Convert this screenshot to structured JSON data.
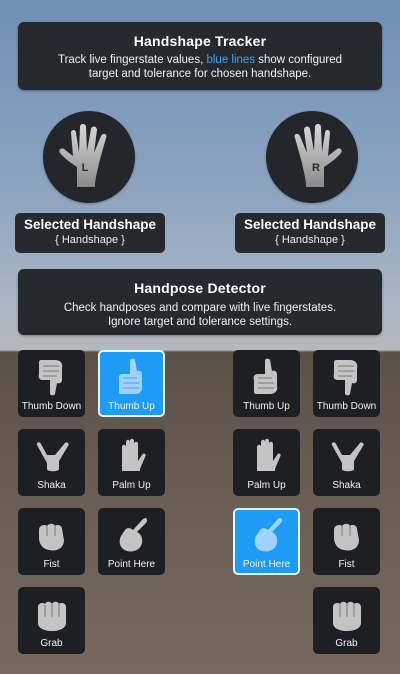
{
  "tracker": {
    "title": "Handshape Tracker",
    "line1_pre": "Track live fingerstate values, ",
    "line1_link": "blue lines",
    "line1_post": " show configured",
    "line2": "target and tolerance for chosen handshape."
  },
  "hands": {
    "left": {
      "letter": "L",
      "icon": "open-hand-icon"
    },
    "right": {
      "letter": "R",
      "icon": "open-hand-icon"
    }
  },
  "selected_left": {
    "title": "Selected Handshape",
    "value": "{ Handshape }"
  },
  "selected_right": {
    "title": "Selected Handshape",
    "value": "{ Handshape }"
  },
  "detector": {
    "title": "Handpose Detector",
    "line1": "Check handposes and compare with live fingerstates.",
    "line2": "Ignore target and tolerance settings."
  },
  "left_poses": [
    {
      "label": "Thumb Down",
      "icon": "thumb-down-icon",
      "active": false
    },
    {
      "label": "Thumb Up",
      "icon": "thumb-up-icon",
      "active": true
    },
    {
      "label": "Shaka",
      "icon": "shaka-icon",
      "active": false
    },
    {
      "label": "Palm Up",
      "icon": "palm-up-icon",
      "active": false
    },
    {
      "label": "Fist",
      "icon": "fist-icon",
      "active": false
    },
    {
      "label": "Point Here",
      "icon": "point-here-icon",
      "active": false
    },
    {
      "label": "Grab",
      "icon": "grab-icon",
      "active": false
    }
  ],
  "right_poses": [
    {
      "label": "Thumb Up",
      "icon": "thumb-up-icon",
      "active": false
    },
    {
      "label": "Thumb Down",
      "icon": "thumb-down-icon",
      "active": false
    },
    {
      "label": "Palm Up",
      "icon": "palm-up-icon",
      "active": false
    },
    {
      "label": "Shaka",
      "icon": "shaka-icon",
      "active": false
    },
    {
      "label": "Point Here",
      "icon": "point-here-icon",
      "active": true
    },
    {
      "label": "Fist",
      "icon": "fist-icon",
      "active": false
    },
    {
      "label": "Grab",
      "icon": "grab-icon",
      "active": false
    }
  ],
  "colors": {
    "accent": "#1d9bf5",
    "panel": "#26292d",
    "tile": "#1d1f22",
    "link": "#36a3ff"
  }
}
